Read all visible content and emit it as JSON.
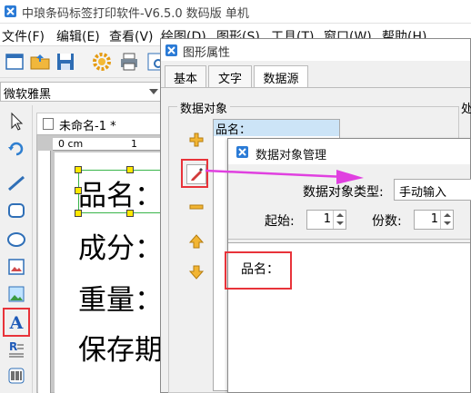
{
  "app": {
    "title": "中琅条码标签打印软件-V6.5.0 数码版 单机"
  },
  "menu": [
    {
      "label": "文件(F)"
    },
    {
      "label": "编辑(E)"
    },
    {
      "label": "查看(V)"
    },
    {
      "label": "绘图(D)"
    },
    {
      "label": "图形(S)"
    },
    {
      "label": "工具(T)"
    },
    {
      "label": "窗口(W)"
    },
    {
      "label": "帮助(H)"
    }
  ],
  "toolbar": {
    "font_value": "微软雅黑",
    "icons": [
      "new-icon",
      "open-folder-icon",
      "save-icon",
      "settings-gear-icon",
      "print-icon",
      "preview-icon"
    ]
  },
  "left_tools": [
    "pointer-icon",
    "rotate-icon",
    "line-icon",
    "rounded-rect-icon",
    "ellipse-icon",
    "image-icon",
    "picture-icon",
    "text-icon",
    "rich-text-icon",
    "barcode-icon"
  ],
  "document": {
    "tab_label": "未命名-1 *",
    "ruler_zero": "0 cm",
    "ruler_one": "1",
    "label_lines": [
      "品名：",
      "成分：",
      "重量：",
      "保存期"
    ]
  },
  "property_dialog": {
    "title": "图形属性",
    "tabs": [
      {
        "label": "基本"
      },
      {
        "label": "文字"
      },
      {
        "label": "数据源"
      }
    ],
    "active_tab": "数据源",
    "group_label": "数据对象",
    "object_list": [
      {
        "label": "品名："
      }
    ],
    "right_cut_label": "处",
    "side_buttons": [
      "add-icon",
      "edit-icon",
      "remove-icon",
      "move-up-icon",
      "move-down-icon"
    ]
  },
  "manager_dialog": {
    "title": "数据对象管理",
    "type_label": "数据对象类型:",
    "type_value": "手动输入",
    "start_label": "起始:",
    "start_value": "1",
    "copies_label": "份数:",
    "copies_value": "1",
    "content": "品名："
  },
  "colors": {
    "highlight_red": "#e8333a",
    "arrow_magenta": "#e040e0",
    "selection_blue": "#cce4f7",
    "handle_yellow": "#ffe800"
  }
}
